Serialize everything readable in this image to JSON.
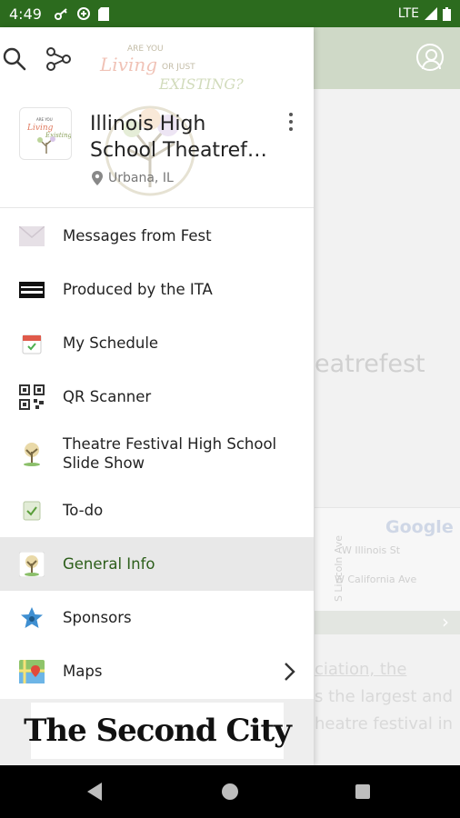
{
  "status_bar": {
    "time": "4:49",
    "network": "LTE"
  },
  "background": {
    "title_fragment": "eatrefest",
    "map_brand": "Google",
    "map_streets": [
      "W Illinois St",
      "W California Ave",
      "S Lincoln Ave"
    ],
    "paragraph_lines": [
      "ciation, the",
      "s the largest and",
      "heatre festival in"
    ]
  },
  "drawer": {
    "watermark_text": [
      "ARE YOU",
      "Living",
      "OR JUST",
      "EXISTING?"
    ],
    "event": {
      "title_line1": "Illinois High",
      "title_line2": "School Theatref…",
      "location": "Urbana, IL"
    },
    "menu": [
      {
        "label": "Messages from Fest",
        "icon": "envelope-icon"
      },
      {
        "label": "Produced by the ITA",
        "icon": "ita-logo-icon"
      },
      {
        "label": "My Schedule",
        "icon": "calendar-icon"
      },
      {
        "label": "QR Scanner",
        "icon": "qr-code-icon"
      },
      {
        "label_line1": "Theatre Festival High School",
        "label_line2": "Slide Show",
        "icon": "tree-logo-icon"
      },
      {
        "label": "To-do",
        "icon": "checklist-icon"
      },
      {
        "label": "General Info",
        "icon": "tree-logo-icon",
        "active": true
      },
      {
        "label": "Sponsors",
        "icon": "star-badge-icon"
      },
      {
        "label": "Maps",
        "icon": "map-icon",
        "has_submenu": true
      }
    ],
    "sponsor_text": "The Second City"
  },
  "colors": {
    "status_bar": "#2c6b1e",
    "active_label": "#2c5e1a",
    "active_bg": "#e8e8e8"
  }
}
